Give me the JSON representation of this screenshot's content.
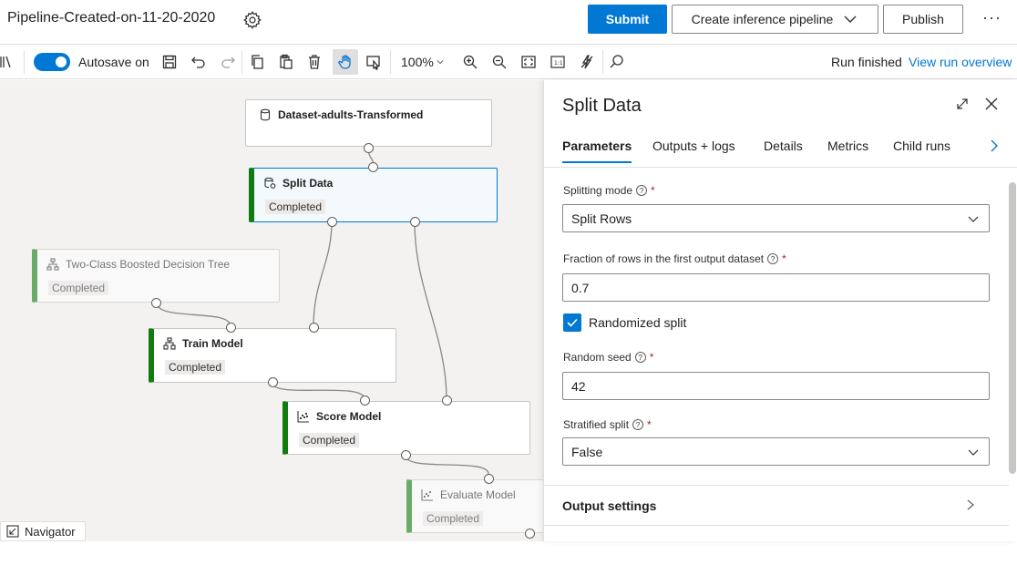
{
  "header": {
    "title": "Pipeline-Created-on-11-20-2020",
    "submit_label": "Submit",
    "inference_label": "Create inference pipeline",
    "publish_label": "Publish",
    "more_label": "···"
  },
  "toolbar": {
    "autosave_label": "Autosave on",
    "autosave_on": true,
    "zoom": "100%",
    "run_status": "Run finished",
    "run_link": "View run overview"
  },
  "canvas": {
    "nodes": [
      {
        "title": "Dataset-adults-Transformed",
        "status": ""
      },
      {
        "title": "Split Data",
        "status": "Completed"
      },
      {
        "title": "Two-Class Boosted Decision Tree",
        "status": "Completed"
      },
      {
        "title": "Train Model",
        "status": "Completed"
      },
      {
        "title": "Score Model",
        "status": "Completed"
      },
      {
        "title": "Evaluate Model",
        "status": "Completed"
      }
    ],
    "navigator_label": "Navigator"
  },
  "panel": {
    "title": "Split Data",
    "tabs": [
      "Parameters",
      "Outputs + logs",
      "Details",
      "Metrics",
      "Child runs"
    ],
    "active_tab": "Parameters",
    "fields": {
      "splitting_mode": {
        "label": "Splitting mode",
        "value": "Split Rows"
      },
      "fraction": {
        "label": "Fraction of rows in the first output dataset",
        "value": "0.7"
      },
      "randomized": {
        "label": "Randomized split",
        "checked": true
      },
      "seed": {
        "label": "Random seed",
        "value": "42"
      },
      "stratified": {
        "label": "Stratified split",
        "value": "False"
      }
    },
    "output_settings_label": "Output settings",
    "required_mark": "*",
    "help_mark": "?"
  },
  "colors": {
    "accent": "#0078d4",
    "completed": "#107c10"
  }
}
